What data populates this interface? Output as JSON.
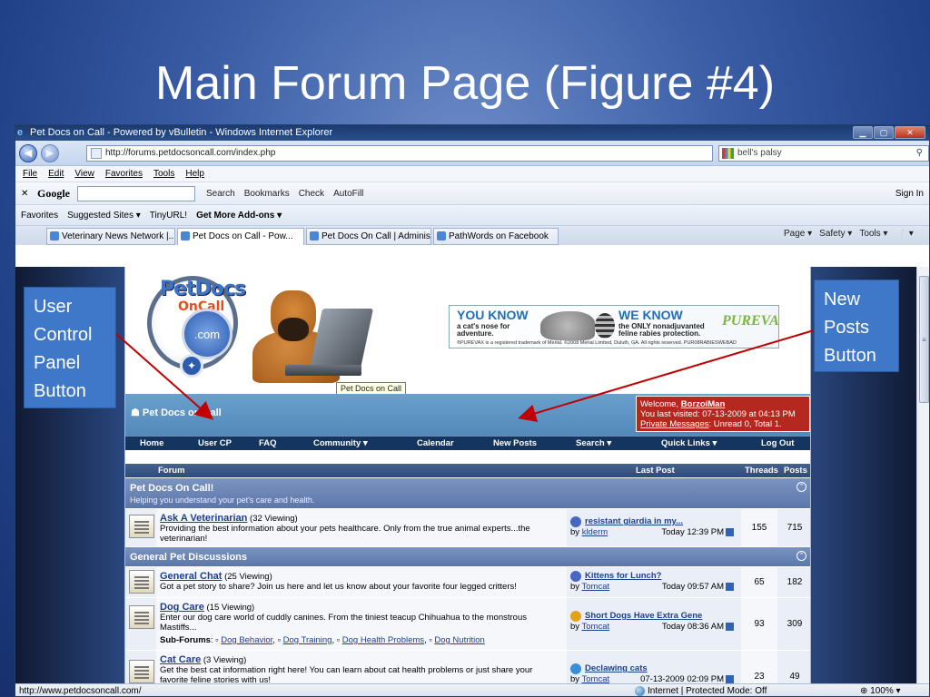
{
  "slide": {
    "title": "Main Forum Page (Figure #4)"
  },
  "window": {
    "title": "Pet Docs on Call - Powered by vBulletin - Windows Internet Explorer",
    "buttons": [
      "▁",
      "▢",
      "✕"
    ]
  },
  "address": {
    "url": "http://forums.petdocsoncall.com/index.php",
    "search_value": "bell's palsy"
  },
  "menu": [
    "File",
    "Edit",
    "View",
    "Favorites",
    "Tools",
    "Help"
  ],
  "google_bar": {
    "close": "✕",
    "logo": "Google",
    "items": [
      "Search",
      "Bookmarks",
      "Check",
      "AutoFill"
    ],
    "sign_in": "Sign In"
  },
  "favorites_bar": {
    "favorites": "Favorites",
    "items": [
      "Suggested Sites ▾",
      "TinyURL!",
      "Get More Add-ons ▾"
    ]
  },
  "tabs": [
    "Veterinary News Network |...",
    "Pet Docs on Call - Pow...",
    "Pet Docs On Call | Adminis...",
    "PathWords on Facebook"
  ],
  "command_bar": [
    "Page ▾",
    "Safety ▾",
    "Tools ▾",
    "❔ ▾"
  ],
  "banner": {
    "logo_line1": "PetDocs",
    "logo_line2": "OnCall",
    "logo_com": ".com",
    "tooltip": "Pet Docs on Call",
    "ad": {
      "h1": "YOU KNOW",
      "t1": "a cat's nose for adventure.",
      "h2": "WE KNOW",
      "t2": "the ONLY nonadjuvanted feline rabies protection.",
      "brand": "PUREVAX",
      "fine": "®PUREVAX is a registered trademark of Merial. ©2008 Merial Limited, Duluth, GA. All rights reserved. PUR08RABIESWEBAD"
    }
  },
  "site_name": "Pet Docs on Call",
  "welcome": {
    "line1": "Welcome, ",
    "user": "BorzoiMan",
    "line2": "You last visited: 07-13-2009 at 04:13 PM",
    "pm_label": "Private Messages",
    "pm_value": ": Unread 0, Total 1."
  },
  "navbar": [
    "Home",
    "User CP",
    "FAQ",
    "Community ▾",
    "Calendar",
    "New Posts",
    "Search ▾",
    "Quick Links ▾",
    "Log Out"
  ],
  "table_header": {
    "forum": "Forum",
    "last_post": "Last Post",
    "threads": "Threads",
    "posts": "Posts"
  },
  "categories": [
    {
      "title": "Pet Docs On Call!",
      "desc": "Helping you understand your pet's care and health.",
      "forums": [
        {
          "name": "Ask A Veterinarian",
          "viewing": "(32 Viewing)",
          "desc": "Providing the best information about your pets healthcare. Only from the true animal experts...the veterinarian!",
          "last_title": "resistant giardia in my...",
          "last_by": "by ",
          "last_user": "klderm",
          "last_time": "Today 12:39 PM",
          "threads": "155",
          "posts": "715"
        }
      ]
    },
    {
      "title": "General Pet Discussions",
      "forums": [
        {
          "name": "General Chat",
          "viewing": "(25 Viewing)",
          "desc": "Got a pet story to share? Join us here and let us know about your favorite four legged critters!",
          "last_title": "Kittens for Lunch?",
          "last_by": "by ",
          "last_user": "Tomcat",
          "last_time": "Today 09:57 AM",
          "threads": "65",
          "posts": "182"
        },
        {
          "name": "Dog Care",
          "viewing": "(15 Viewing)",
          "desc": "Enter our dog care world of cuddly canines. From the tiniest teacup Chihuahua to the monstrous Mastiffs...",
          "sub_label": "Sub-Forums",
          "subs": [
            "Dog Behavior",
            "Dog Training",
            "Dog Health Problems",
            "Dog Nutrition"
          ],
          "last_title": "Short Dogs Have Extra Gene",
          "last_by": "by ",
          "last_user": "Tomcat",
          "last_time": "Today 08:36 AM",
          "threads": "93",
          "posts": "309"
        },
        {
          "name": "Cat Care",
          "viewing": "(3 Viewing)",
          "desc": "Get the best cat information right here! You can learn about cat health problems or just share your favorite feline stories with us!",
          "last_title": "Declawing cats",
          "last_by": "by ",
          "last_user": "Tomcat",
          "last_time": "07-13-2009 02:09 PM",
          "threads": "23",
          "posts": "49"
        }
      ]
    }
  ],
  "status": {
    "url": "http://www.petdocsoncall.com/",
    "zone": "Internet | Protected Mode: Off",
    "zoom": "100%"
  },
  "callouts": {
    "left": [
      "User",
      "Control",
      "Panel",
      "Button"
    ],
    "right": [
      "New",
      "Posts",
      "Button"
    ]
  },
  "colors": {
    "slide_bg": "#3b5ea6",
    "callout": "#3f78c8",
    "nav": "#14355f",
    "welcome": "#b5281f",
    "arrow": "#c00000"
  }
}
